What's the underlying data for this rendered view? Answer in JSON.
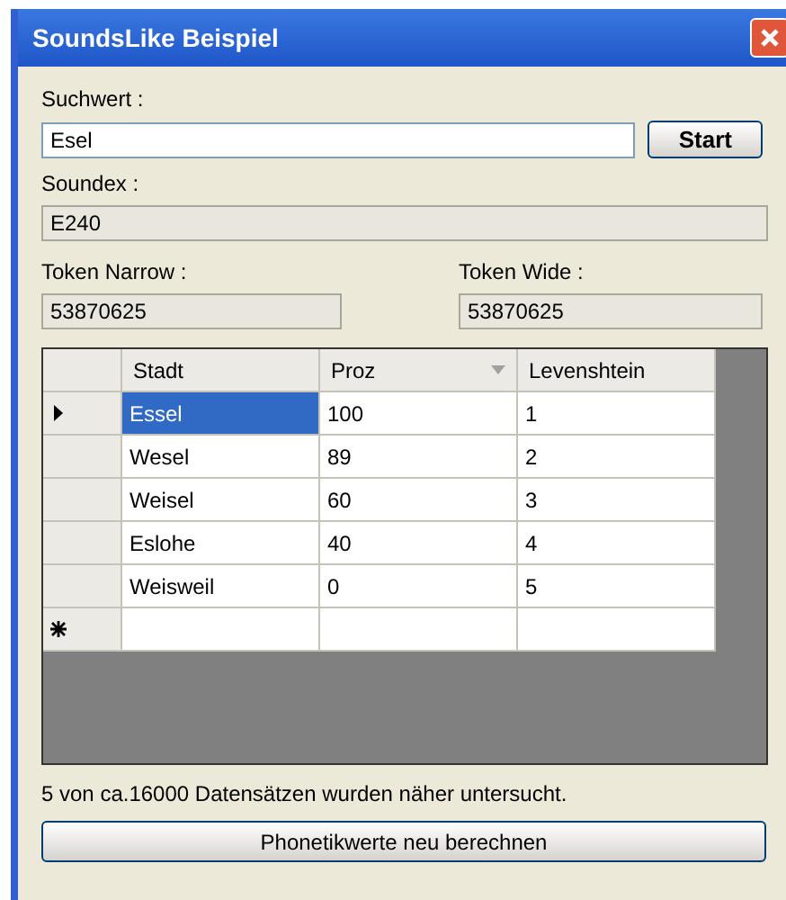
{
  "window": {
    "title": "SoundsLike Beispiel"
  },
  "search": {
    "label": "Suchwert :",
    "value": "Esel"
  },
  "start_button": "Start",
  "soundex": {
    "label": "Soundex :",
    "value": "E240"
  },
  "token_narrow": {
    "label": "Token Narrow :",
    "value": "53870625"
  },
  "token_wide": {
    "label": "Token Wide :",
    "value": "53870625"
  },
  "grid": {
    "columns": [
      {
        "label": "Stadt",
        "sorted": false
      },
      {
        "label": "Proz",
        "sorted": true
      },
      {
        "label": "Levenshtein",
        "sorted": false
      }
    ],
    "rows": [
      {
        "current": true,
        "cells": [
          {
            "text": "Essel",
            "selected": true
          },
          {
            "text": "100",
            "selected": false
          },
          {
            "text": "1",
            "selected": false
          }
        ]
      },
      {
        "current": false,
        "cells": [
          {
            "text": "Wesel",
            "selected": false
          },
          {
            "text": "89",
            "selected": false
          },
          {
            "text": "2",
            "selected": false
          }
        ]
      },
      {
        "current": false,
        "cells": [
          {
            "text": "Weisel",
            "selected": false
          },
          {
            "text": "60",
            "selected": false
          },
          {
            "text": "3",
            "selected": false
          }
        ]
      },
      {
        "current": false,
        "cells": [
          {
            "text": "Eslohe",
            "selected": false
          },
          {
            "text": "40",
            "selected": false
          },
          {
            "text": "4",
            "selected": false
          }
        ]
      },
      {
        "current": false,
        "cells": [
          {
            "text": "Weisweil",
            "selected": false
          },
          {
            "text": "0",
            "selected": false
          },
          {
            "text": "5",
            "selected": false
          }
        ]
      }
    ],
    "new_row": true
  },
  "status": "5 von ca.16000 Datensätzen wurden näher untersucht.",
  "recalc_button": "Phonetikwerte neu berechnen"
}
